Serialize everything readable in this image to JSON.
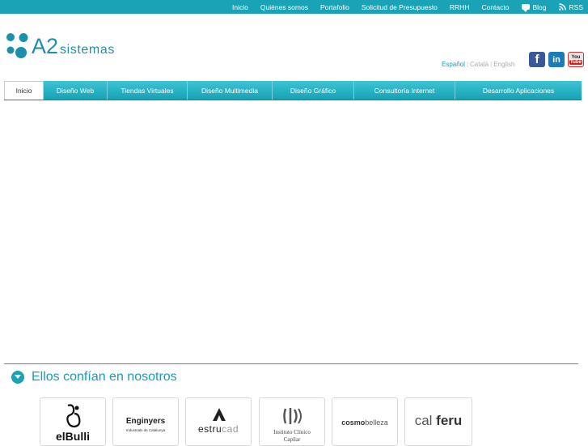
{
  "topnav": {
    "items": [
      "Inicio",
      "Quiénes somos",
      "Portafolio",
      "Solicitud de Presupuesto",
      "RRHH",
      "Contacto"
    ],
    "blog": "Blog",
    "rss": "RSS"
  },
  "logo": {
    "a2": "A2",
    "sistemas": "sistemas"
  },
  "languages": {
    "active": "Español",
    "catala": "Català",
    "english": "English"
  },
  "social": {
    "facebook": "f",
    "linkedin": "in",
    "youtube_you": "You",
    "youtube_tube": "Tube"
  },
  "mainnav": {
    "items": [
      "Inicio",
      "Diseño Web",
      "Tiendas Virtuales",
      "Diseño Multimedia",
      "Diseño Gráfico",
      "Consultoría Internet",
      "Desarrollo Aplicaciones"
    ]
  },
  "section": {
    "title": "Ellos confían en nosotros"
  },
  "clients": {
    "elbulli": "elBulli",
    "enginyers_name": "Enginyers",
    "enginyers_sub": "Industrials de Catalunya",
    "estrucad_a": "estru",
    "estrucad_b": "cad",
    "instituto_1": "Instituto Clínico",
    "instituto_2": "Capilar",
    "cosmo_a": "cosmo",
    "cosmo_b": "belleza",
    "calferu_a": "cal ",
    "calferu_b": "feru"
  },
  "colors": {
    "brand": "#1aa3b6",
    "text_accent": "#1a9bb8",
    "facebook": "#3b5998",
    "linkedin": "#1d7ab8"
  },
  "icons": [
    "blog-icon",
    "rss-icon",
    "facebook-icon",
    "linkedin-icon",
    "youtube-icon",
    "chevron-down-icon"
  ]
}
